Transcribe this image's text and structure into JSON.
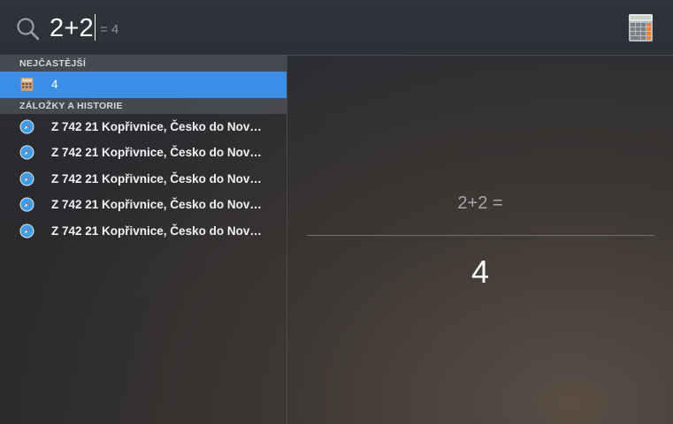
{
  "search": {
    "query": "2+2",
    "inline_result": "= 4"
  },
  "sections": [
    {
      "header": "NEJČASTĚJŠÍ",
      "items": [
        {
          "label": "4",
          "icon": "calculator-icon",
          "selected": true
        }
      ]
    },
    {
      "header": "ZÁLOŽKY A HISTORIE",
      "items": [
        {
          "label": "Z 742 21 Kopřivnice, Česko do Nov…",
          "icon": "safari-icon"
        },
        {
          "label": "Z 742 21 Kopřivnice, Česko do Nov…",
          "icon": "safari-icon"
        },
        {
          "label": "Z 742 21 Kopřivnice, Česko do Nov…",
          "icon": "safari-icon"
        },
        {
          "label": "Z 742 21 Kopřivnice, Česko do Nov…",
          "icon": "safari-icon"
        },
        {
          "label": "Z 742 21 Kopřivnice, Česko do Nov…",
          "icon": "safari-icon"
        }
      ]
    }
  ],
  "preview": {
    "expression": "2+2 =",
    "result": "4"
  },
  "colors": {
    "selection": "#3a8ee6"
  }
}
